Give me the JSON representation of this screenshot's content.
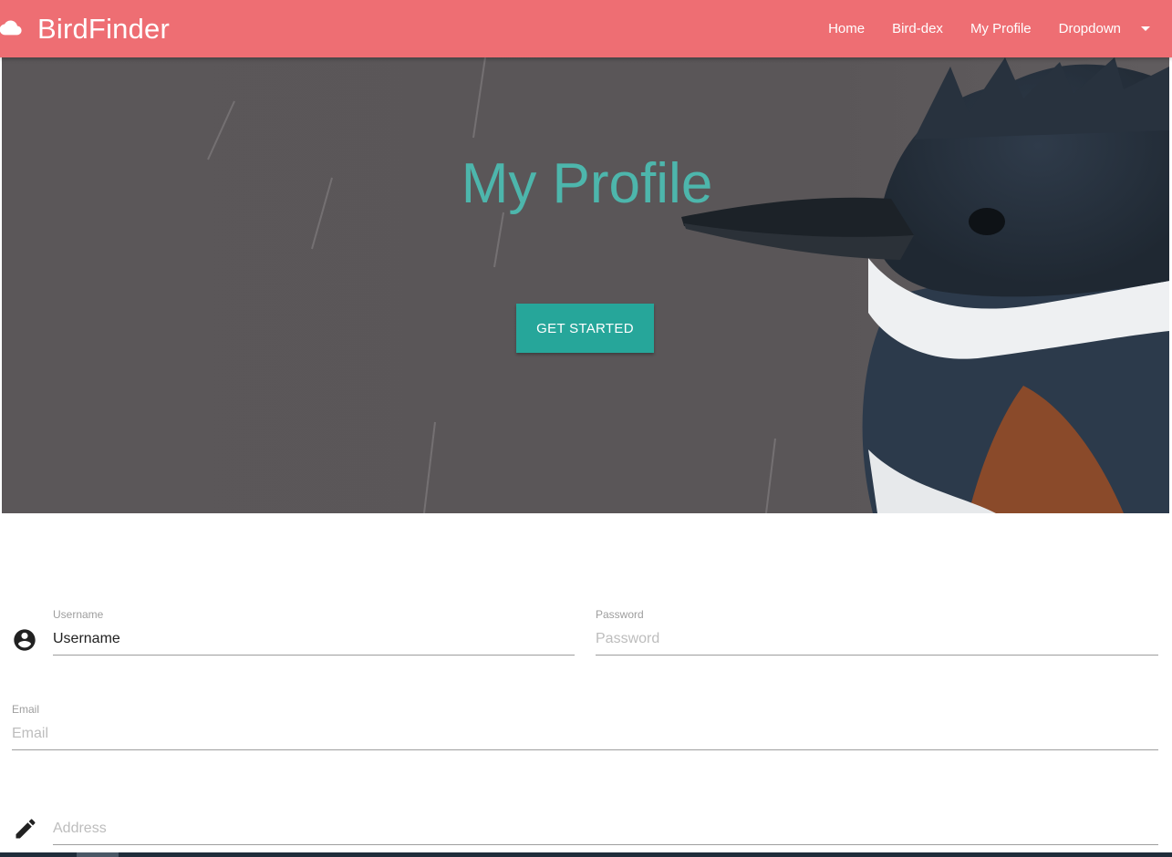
{
  "navbar": {
    "brand": "BirdFinder",
    "brand_icon": "cloud-icon",
    "links": [
      "Home",
      "Bird-dex",
      "My Profile"
    ],
    "dropdown_label": "Dropdown",
    "background_color": "#ee6e73"
  },
  "hero": {
    "title": "My Profile",
    "cta_label": "GET STARTED",
    "title_color": "#4db6ac",
    "cta_color": "#26a69a"
  },
  "form": {
    "username": {
      "label": "Username",
      "value": "Username",
      "icon": "account-circle-icon"
    },
    "password": {
      "label": "Password",
      "placeholder": "Password"
    },
    "email": {
      "label": "Email",
      "placeholder": "Email"
    },
    "address": {
      "placeholder": "Address",
      "icon": "pencil-icon"
    }
  }
}
